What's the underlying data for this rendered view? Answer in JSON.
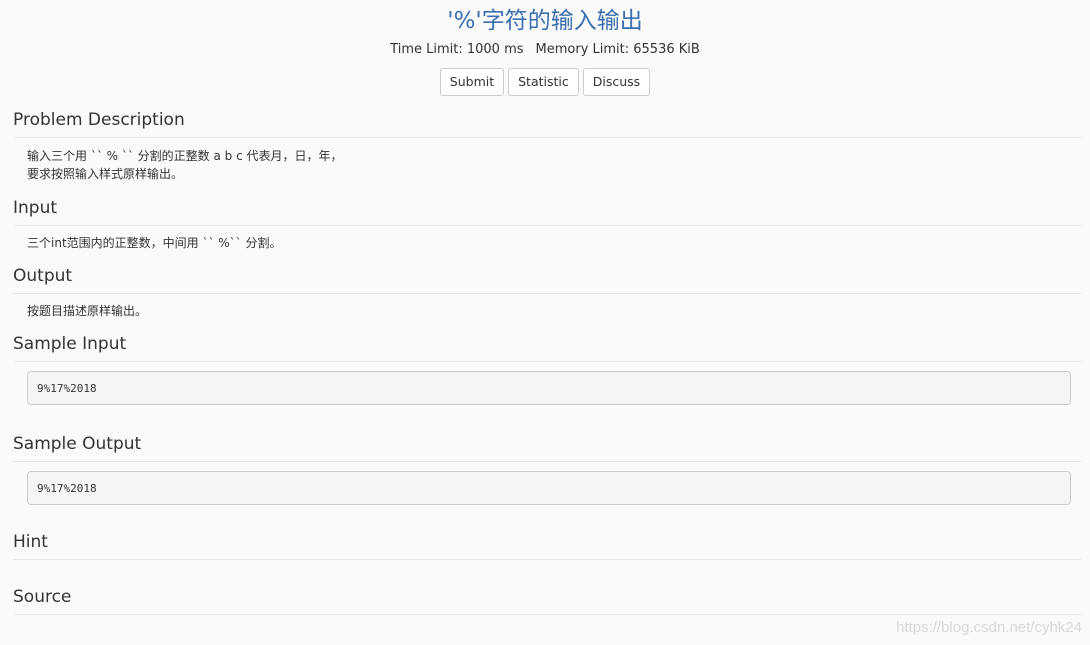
{
  "problem": {
    "title": "'%'字符的输入输出",
    "time_limit": "Time Limit: 1000 ms",
    "memory_limit": "Memory Limit: 65536 KiB"
  },
  "buttons": {
    "submit": "Submit",
    "statistic": "Statistic",
    "discuss": "Discuss"
  },
  "sections": {
    "description": {
      "heading": "Problem Description",
      "lines": [
        "输入三个用 `` % `` 分割的正整数 a b c 代表月，日，年，",
        "要求按照输入样式原样输出。"
      ]
    },
    "input": {
      "heading": "Input",
      "text": "三个int范围内的正整数，中间用 `` %`` 分割。"
    },
    "output": {
      "heading": "Output",
      "text": "按题目描述原样输出。"
    },
    "sample_input": {
      "heading": "Sample Input",
      "code": "9%17%2018"
    },
    "sample_output": {
      "heading": "Sample Output",
      "code": "9%17%2018"
    },
    "hint": {
      "heading": "Hint"
    },
    "source": {
      "heading": "Source"
    }
  },
  "watermark": "https://blog.csdn.net/cyhk24"
}
